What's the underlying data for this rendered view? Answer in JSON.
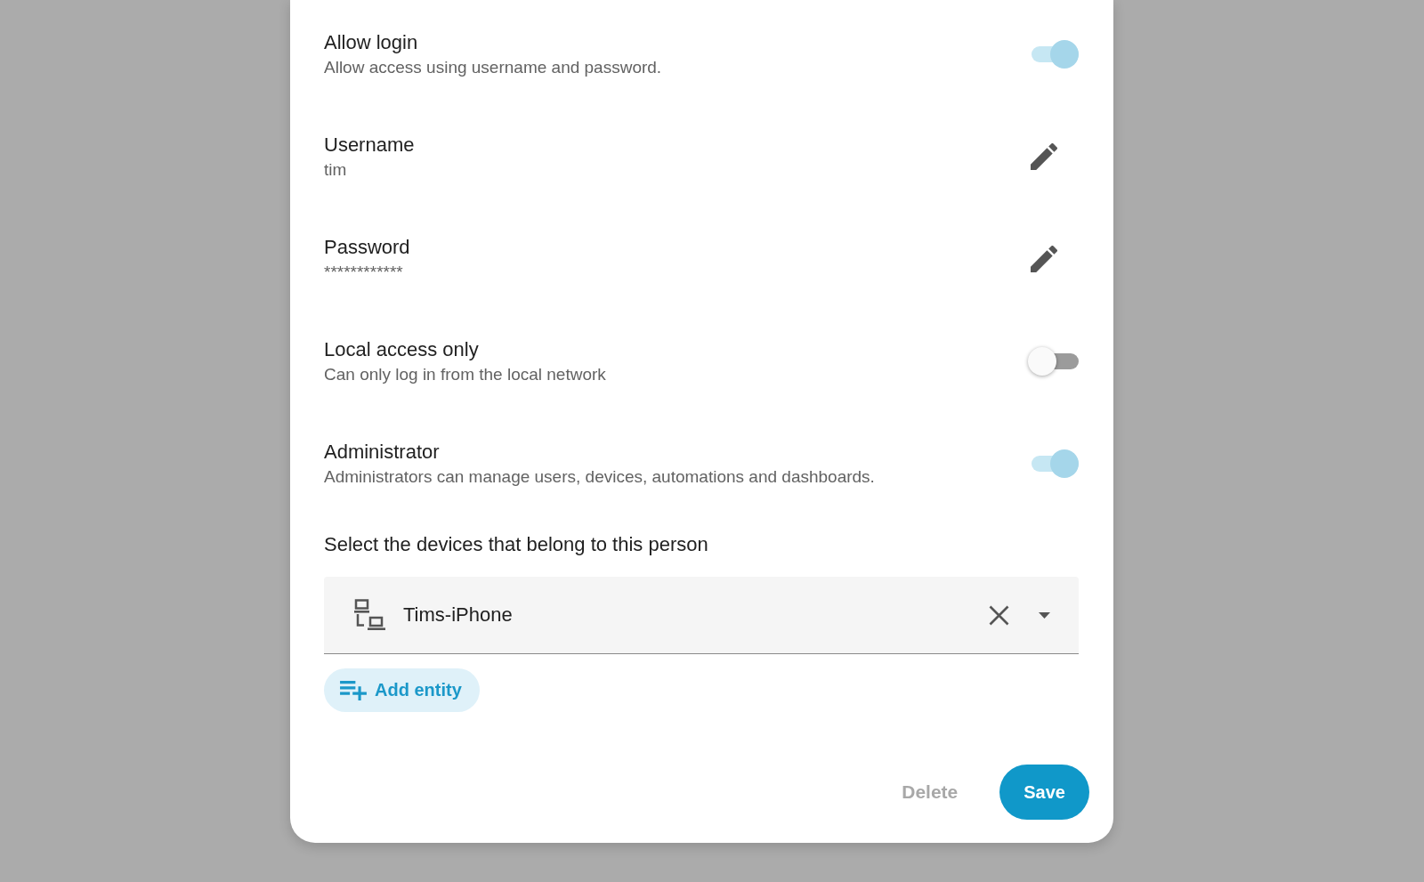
{
  "dialog": {
    "settings": [
      {
        "kind": "toggle",
        "title": "Allow login",
        "subtitle": "Allow access using username and password.",
        "on": true
      },
      {
        "kind": "edit",
        "title": "Username",
        "value": "tim"
      },
      {
        "kind": "edit",
        "title": "Password",
        "value": "************"
      },
      {
        "kind": "toggle",
        "title": "Local access only",
        "subtitle": "Can only log in from the local network",
        "on": false
      },
      {
        "kind": "toggle",
        "title": "Administrator",
        "subtitle": "Administrators can manage users, devices, automations and dashboards.",
        "on": true
      }
    ],
    "devices": {
      "label": "Select the devices that belong to this person",
      "value": "Tims-iPhone"
    },
    "add_entity_button": {
      "label": "Add entity"
    },
    "buttons": [
      {
        "kind": "text",
        "label": "Delete",
        "disabled": true
      },
      {
        "kind": "filled",
        "label": "Save",
        "disabled": false
      }
    ]
  }
}
